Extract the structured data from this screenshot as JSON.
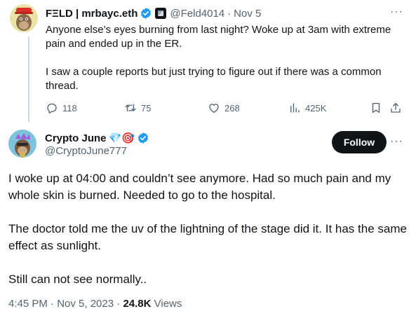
{
  "parent_tweet": {
    "display_name": "FΞLD | mrbayc.eth",
    "handle": "@Feld4014",
    "separator": "·",
    "date": "Nov 5",
    "paragraphs": [
      "Anyone else’s eyes burning from last night? Woke up at 3am with extreme pain and ended up in the ER.",
      "I saw a couple reports but just trying to figure out if there was a common thread."
    ],
    "stats": {
      "replies": "118",
      "retweets": "75",
      "likes": "268",
      "views": "425K"
    },
    "more": "···"
  },
  "main_tweet": {
    "display_name": "Crypto June",
    "name_emojis": "💎🎯",
    "handle": "@CryptoJune777",
    "follow_label": "Follow",
    "more": "···",
    "paragraphs": [
      "I woke up at 04:00 and couldn’t see anymore. Had so much pain and my whole skin is burned. Needed to go to the hospital.",
      "The doctor told me the uv of the lightning of the stage did it. It has the same effect as sunlight.",
      "Still can not see normally.."
    ],
    "timestamp": "4:45 PM · Nov 5, 2023",
    "meta_separator": " · ",
    "views_count": "24.8K",
    "views_label": " Views"
  },
  "colors": {
    "text": "#0f1419",
    "secondary": "#536471",
    "verified_blue": "#1d9bf0",
    "thread_line": "#cfd9de"
  },
  "icons": [
    "reply-icon",
    "retweet-icon",
    "like-icon",
    "views-icon",
    "bookmark-icon",
    "share-icon",
    "verified-icon",
    "affiliate-badge-icon"
  ]
}
